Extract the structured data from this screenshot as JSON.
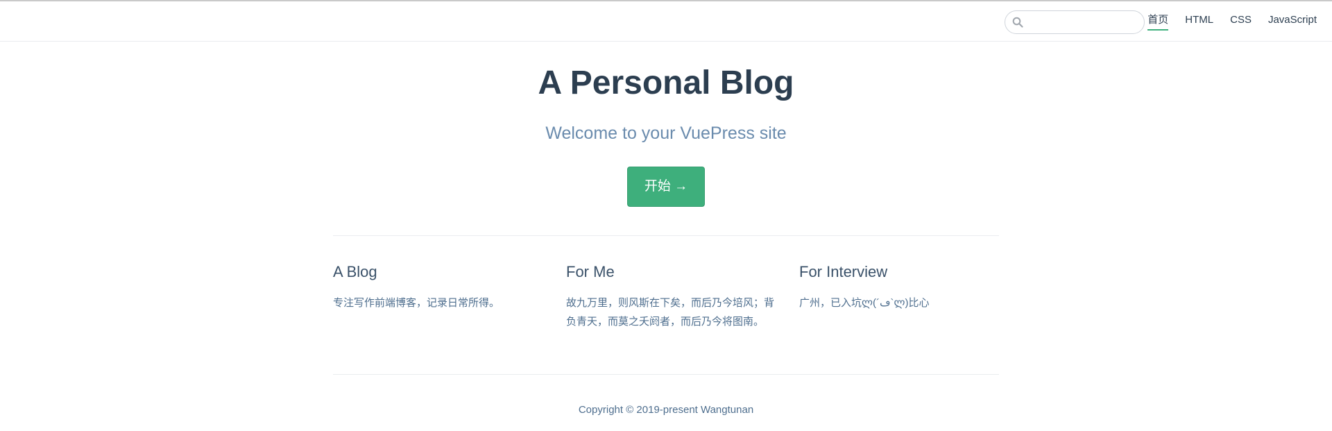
{
  "search": {
    "placeholder": "",
    "value": ""
  },
  "nav": {
    "items": [
      {
        "label": "首页",
        "active": true
      },
      {
        "label": "HTML",
        "active": false
      },
      {
        "label": "CSS",
        "active": false
      },
      {
        "label": "JavaScript",
        "active": false
      }
    ]
  },
  "hero": {
    "title": "A Personal Blog",
    "description": "Welcome to your VuePress site",
    "action_label": "开始 →"
  },
  "features": [
    {
      "title": "A Blog",
      "details": "专注写作前端博客，记录日常所得。"
    },
    {
      "title": "For Me",
      "details": "故九万里，则风斯在下矣，而后乃今培风；背负青天，而莫之夭阏者，而后乃今将图南。"
    },
    {
      "title": "For Interview",
      "details": "广州，已入坑ლ(´ڡ`ლ)比心"
    }
  ],
  "footer": {
    "text": "Copyright © 2019-present Wangtunan"
  },
  "colors": {
    "accent": "#3eaf7c",
    "text": "#2c3e50",
    "muted": "#6a8bad"
  },
  "icons": {
    "search": "search-icon"
  }
}
